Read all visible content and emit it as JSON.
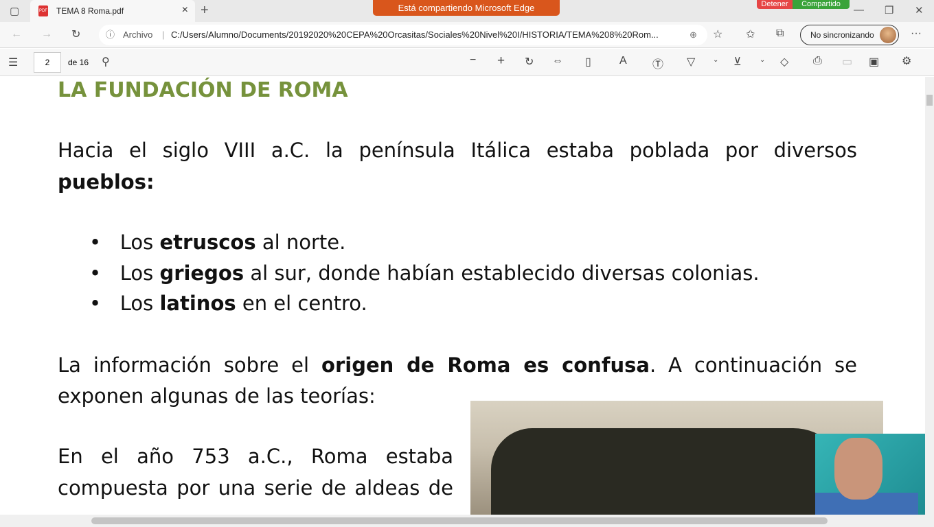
{
  "tab": {
    "title": "TEMA 8 Roma.pdf",
    "pdf_badge": "PDF"
  },
  "share_banner": "Está compartiendo Microsoft Edge",
  "share_controls": {
    "stop": "Detener",
    "shared": "Compartido"
  },
  "address": {
    "label": "Archivo",
    "url": "C:/Users/Alumno/Documents/20192020%20CEPA%20Orcasitas/Sociales%20Nivel%20I/HISTORIA/TEMA%208%20Rom..."
  },
  "profile": {
    "label": "No sincronizando"
  },
  "pdf_toolbar": {
    "page": "2",
    "of_pages": "de 16"
  },
  "doc": {
    "title": "LA FUNDACIÓN DE ROMA",
    "p1": "Hacia el siglo VIII a.C. la península Itálica estaba poblada por diversos",
    "p1b": "pueblos",
    "bullets": [
      {
        "pre": "Los ",
        "bold": "etruscos",
        "post": " al norte."
      },
      {
        "pre": "Los ",
        "bold": "griegos",
        "post": " al sur, donde habían establecido diversas colonias."
      },
      {
        "pre": "Los ",
        "bold": "latinos",
        "post": " en el centro."
      }
    ],
    "p2a": "La información sobre el ",
    "p2b": "origen de Roma es confusa",
    "p2c": ". A continuación se",
    "p2d": "exponen algunas de las teorías:",
    "p3a": "En el año 753 a.C., Roma estaba",
    "p3b": "compuesta por una serie de aldeas de"
  }
}
